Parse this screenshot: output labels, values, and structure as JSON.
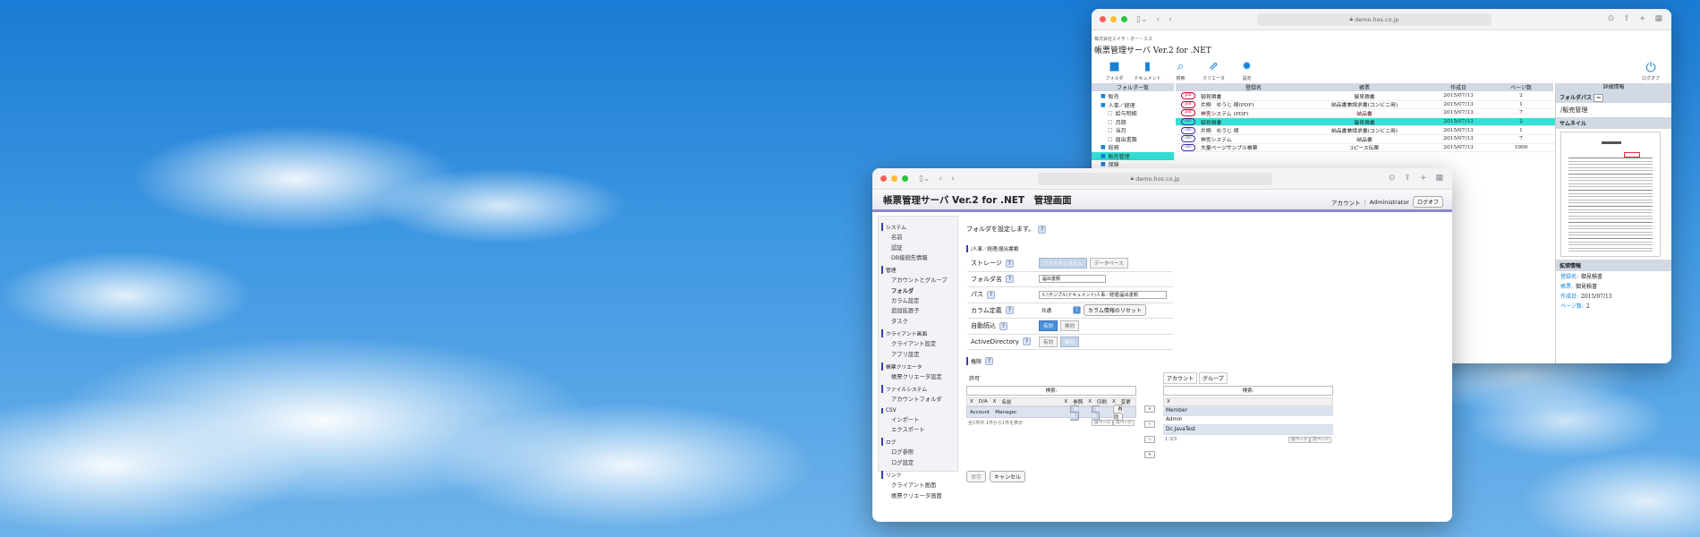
{
  "back_window": {
    "url": "demo.hos.co.jp",
    "company": "株式会社エイチ・オー・エス",
    "app_title": "帳票管理サーバ Ver.2 for .NET",
    "toolbar": [
      {
        "icon": "folder-icon",
        "label": "フォルダ"
      },
      {
        "icon": "document-icon",
        "label": "ドキュメント"
      },
      {
        "icon": "search-icon",
        "label": "検索"
      },
      {
        "icon": "external-link-icon",
        "label": "クリエータ"
      },
      {
        "icon": "gear-icon",
        "label": "設定"
      }
    ],
    "logout_label": "ログオフ",
    "folder_header": "フォルダ一覧",
    "folders": [
      {
        "name": "販売",
        "level": 0,
        "selected": false
      },
      {
        "name": "人事／経理",
        "level": 0,
        "selected": false
      },
      {
        "name": "給与明細",
        "level": 1,
        "selected": false
      },
      {
        "name": "月期",
        "level": 1,
        "selected": false
      },
      {
        "name": "当月",
        "level": 1,
        "selected": false
      },
      {
        "name": "届出書類",
        "level": 1,
        "selected": false
      },
      {
        "name": "総務",
        "level": 0,
        "selected": false
      },
      {
        "name": "販売管理",
        "level": 0,
        "selected": true
      },
      {
        "name": "保険",
        "level": 0,
        "selected": false
      }
    ],
    "columns": [
      "登録名",
      "帳票",
      "作成日",
      "ページ数"
    ],
    "rows": [
      {
        "type": "pdf",
        "name": "御見積書",
        "form": "御見積書",
        "date": "2015/07/13",
        "pages": "2",
        "selected": false
      },
      {
        "type": "pdf",
        "name": "片桐　ゆうじ 様(PDF)",
        "form": "納品書兼請求書(コンビニ用)",
        "date": "2015/07/13",
        "pages": "1",
        "selected": false
      },
      {
        "type": "pdf",
        "name": "神宮システム (PDF)",
        "form": "納品書",
        "date": "2015/07/13",
        "pages": "7",
        "selected": false
      },
      {
        "type": "csv",
        "name": "御見積書",
        "form": "御見積書",
        "date": "2015/07/13",
        "pages": "2",
        "selected": true
      },
      {
        "type": "csv",
        "name": "片桐　ゆうじ 様",
        "form": "納品書兼請求書(コンビニ用)",
        "date": "2015/07/13",
        "pages": "1",
        "selected": false
      },
      {
        "type": "csv",
        "name": "神宮システム",
        "form": "納品書",
        "date": "2015/07/13",
        "pages": "7",
        "selected": false
      },
      {
        "type": "csv",
        "name": "大量ページサンプル帳票",
        "form": "3ピース伝票",
        "date": "2015/07/13",
        "pages": "1000",
        "selected": false
      }
    ],
    "detail": {
      "header": "詳細情報",
      "folder_path_label": "フォルダパス",
      "folder_path": "/販売管理",
      "thumbnail_label": "サムネイル",
      "extended_label": "拡張情報",
      "fields": [
        {
          "k": "登録名:",
          "v": "御見積書"
        },
        {
          "k": "帳票:",
          "v": "御見積書"
        },
        {
          "k": "作成日:",
          "v": "2015/07/13"
        },
        {
          "k": "ページ数:",
          "v": "2"
        }
      ]
    }
  },
  "front_window": {
    "url": "demo.hos.co.jp",
    "title": "帳票管理サーバ Ver.2 for .NET　管理画面",
    "account_label": "アカウント",
    "account_name": "Administrator",
    "logout": "ログオフ",
    "sidebar": [
      {
        "group": "システム",
        "items": [
          "名前",
          "認証",
          "DB接続先情報"
        ]
      },
      {
        "group": "管理",
        "items": [
          "アカウントとグループ",
          "フォルダ",
          "カラム設定",
          "追加拡張子",
          "タスク"
        ]
      },
      {
        "group": "クライアント画面",
        "items": [
          "クライアント設定",
          "アプリ設定"
        ]
      },
      {
        "group": "帳票クリエータ",
        "items": [
          "帳票クリエータ設定"
        ]
      },
      {
        "group": "ファイルシステム",
        "items": [
          "アカウントフォルダ"
        ]
      },
      {
        "group": "CSV",
        "items": [
          "インポート",
          "エクスポート"
        ]
      },
      {
        "group": "ログ",
        "items": [
          "ログ参照",
          "ログ設定"
        ]
      },
      {
        "group": "リンク",
        "items": [
          "クライアント画面",
          "帳票クリエータ画面"
        ]
      }
    ],
    "active_item": "フォルダ",
    "description": "フォルダを設定します。",
    "path": "/人事／経理/届出書類",
    "form": {
      "storage_label": "ストレージ",
      "storage_opts": [
        "ファイルシステム",
        "データベース"
      ],
      "folder_name_label": "フォルダ名",
      "folder_name": "届出書類",
      "path_label": "パス",
      "path_value": "C:\\サンプル\\ドキュメント\\人事／経理\\届出書類",
      "column_label": "カラム定義",
      "column_value": "共通",
      "column_reset": "カラム情報のリセット",
      "auto_label": "自動読込",
      "auto_opts": [
        "有効",
        "無効"
      ],
      "ad_label": "ActiveDirectory",
      "ad_opts": [
        "有効",
        "無効"
      ]
    },
    "perm_section": "権限",
    "perm": {
      "header": "許可",
      "search": "検索:",
      "cols": [
        "Ⅹ",
        "D/A",
        "Ⅹ",
        "名前",
        "Ⅹ",
        "参照",
        "Ⅹ",
        "印刷",
        "Ⅹ",
        "変更"
      ],
      "row": {
        "type": "Account",
        "name": "Manager",
        "v1": "有効",
        "v2": "有効",
        "v3": "有効"
      },
      "info": "全1件中 1件から1件を表示",
      "prev": "前ページ",
      "next": "次ページ"
    },
    "accounts": {
      "tabs": [
        "アカウント",
        "グループ"
      ],
      "search": "検索:",
      "items": [
        "Member",
        "Admin",
        "Dc.JavaTest"
      ],
      "count": "1-3/3",
      "prev": "前ページ",
      "next": "次ページ"
    },
    "save": "保存",
    "cancel": "キャンセル"
  }
}
